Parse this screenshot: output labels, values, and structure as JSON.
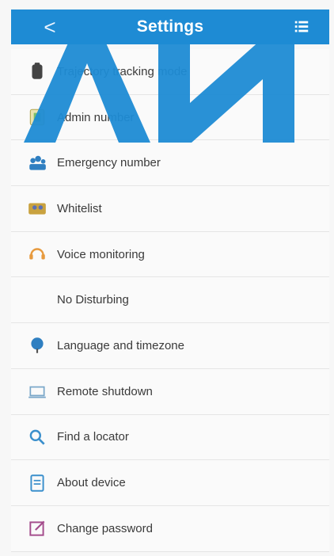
{
  "header": {
    "back_glyph": "<",
    "title": "Settings",
    "menu_icon": "list-icon"
  },
  "items": [
    {
      "label": "Trajectory tracking mode",
      "icon": "device-icon"
    },
    {
      "label": "Admin number",
      "icon": "phone-card-icon"
    },
    {
      "label": "Emergency number",
      "icon": "group-icon"
    },
    {
      "label": "Whitelist",
      "icon": "contacts-icon"
    },
    {
      "label": "Voice monitoring",
      "icon": "headset-icon"
    },
    {
      "label": "No Disturbing",
      "icon": "moon-icon"
    },
    {
      "label": "Language and timezone",
      "icon": "globe-icon"
    },
    {
      "label": "Remote shutdown",
      "icon": "laptop-icon"
    },
    {
      "label": "Find a locator",
      "icon": "search-icon"
    },
    {
      "label": "About device",
      "icon": "document-icon"
    },
    {
      "label": "Change password",
      "icon": "edit-icon"
    }
  ],
  "colors": {
    "header_bg": "#1e8bd4",
    "watermark": "#1e8bd4"
  }
}
